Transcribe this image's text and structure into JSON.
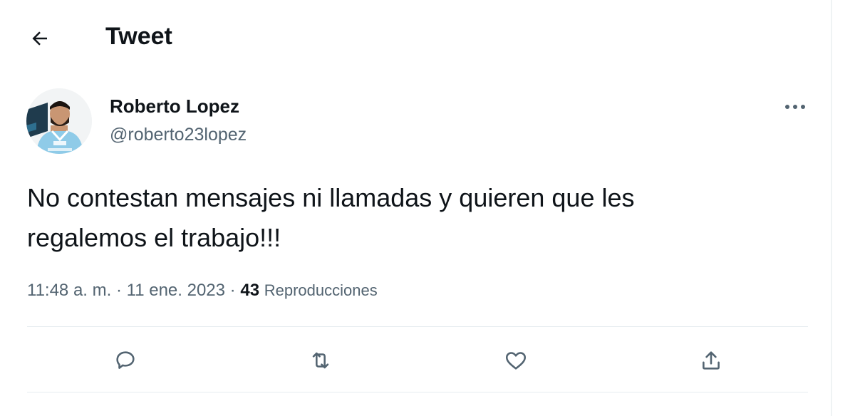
{
  "header": {
    "title": "Tweet",
    "back_icon": "arrow-left-icon"
  },
  "author": {
    "name": "Roberto Lopez",
    "handle": "@roberto23lopez",
    "more_icon": "more-horizontal-icon"
  },
  "tweet": {
    "text_line1": "No contestan mensajes ni llamadas y quieren que les",
    "text_line2": "regalemos el trabajo!!!"
  },
  "meta": {
    "time": "11:48 a. m.",
    "separator": "·",
    "date": "11 ene. 2023",
    "views_count": "43",
    "views_label": "Reproducciones"
  },
  "actions": [
    {
      "icon": "reply-icon"
    },
    {
      "icon": "retweet-icon"
    },
    {
      "icon": "like-icon"
    },
    {
      "icon": "share-icon"
    }
  ],
  "colors": {
    "text": "#0f1419",
    "secondary": "#536471",
    "divider": "#e6ecf0",
    "jersey": "#8fcbe8"
  }
}
